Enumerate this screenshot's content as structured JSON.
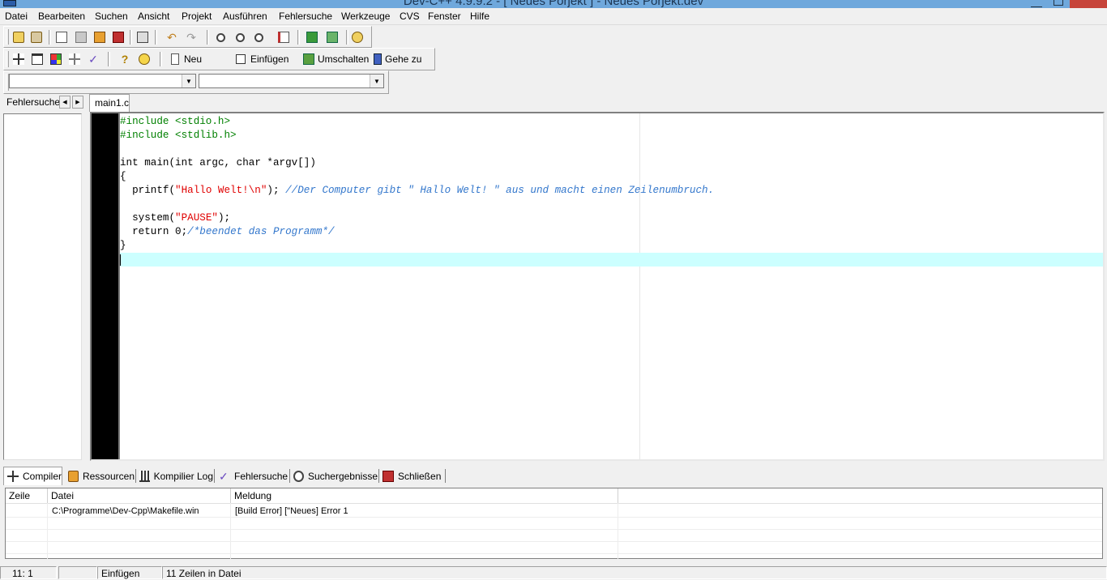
{
  "window": {
    "title": "Dev-C++ 4.9.9.2  - [ Neues Porjekt ] - Neues Porjekt.dev"
  },
  "menu": {
    "items": [
      "Datei",
      "Bearbeiten",
      "Suchen",
      "Ansicht",
      "Projekt",
      "Ausführen",
      "Fehlersuche",
      "Werkzeuge",
      "CVS",
      "Fenster",
      "Hilfe"
    ]
  },
  "toolbar2": {
    "new_label": "Neu",
    "insert_label": "Einfügen",
    "toggle_label": "Umschalten",
    "goto_label": "Gehe zu"
  },
  "class_combo": {
    "value": ""
  },
  "member_combo": {
    "value": ""
  },
  "left_panel": {
    "tab_label": "Fehlersuche"
  },
  "editor": {
    "tab_label": "main1.c",
    "lines": [
      "#include <stdio.h>",
      "#include <stdlib.h>",
      "",
      "int main(int argc, char *argv[])",
      "{",
      "  printf(\"Hallo Welt!\\n\"); //Der Computer gibt \" Hallo Welt! \" aus und macht einen Zeilenumbruch.",
      "",
      "  system(\"PAUSE\");",
      "  return 0;/*beendet das Programm*/",
      "}",
      ""
    ],
    "syntax_colors": {
      "preprocessor": "#008000",
      "string": "#e00000",
      "comment": "#3377cc",
      "current_line": "#ccffff"
    }
  },
  "bottom_tabs": [
    "Compiler",
    "Ressourcen",
    "Kompilier Log",
    "Fehlersuche",
    "Suchergebnisse",
    "Schließen"
  ],
  "compiler_list": {
    "columns": [
      "Zeile",
      "Datei",
      "Meldung"
    ],
    "rows": [
      {
        "line": "",
        "file": "C:\\Programme\\Dev-Cpp\\Makefile.win",
        "message": "[Build Error]  [\"Neues] Error 1"
      }
    ]
  },
  "status": {
    "position": "11: 1",
    "modified": "",
    "mode": "Einfügen",
    "lines_info": "11 Zeilen in Datei"
  }
}
